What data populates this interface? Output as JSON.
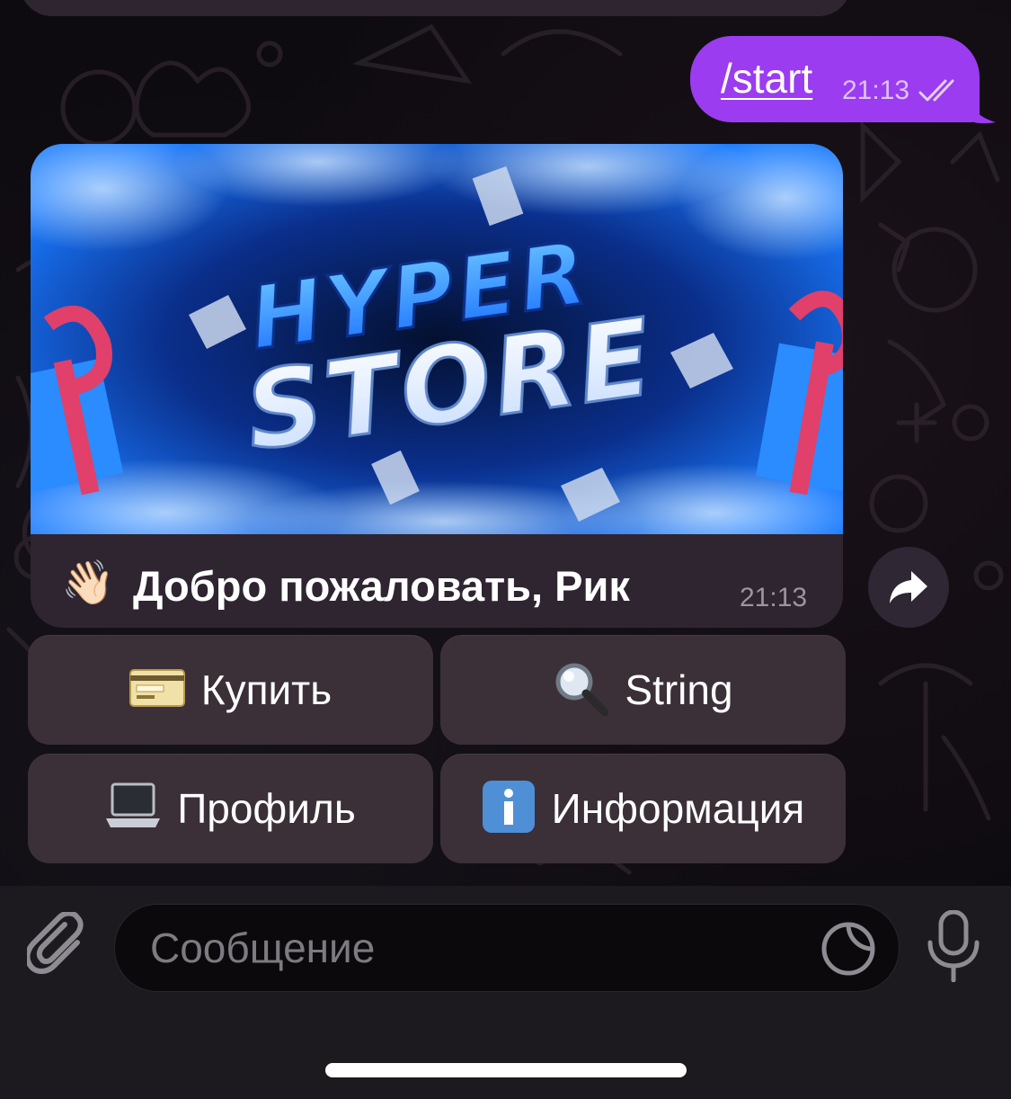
{
  "outgoing_message": {
    "text": "/start",
    "time": "21:13",
    "read_status_icon": "double-check-icon"
  },
  "incoming_message": {
    "banner": {
      "line1": "HYPER",
      "line2": "STORE"
    },
    "emoji": "👋🏻",
    "text": "Добро пожаловать, Рик",
    "time": "21:13"
  },
  "share_icon": "share-arrow-icon",
  "keyboard": [
    {
      "emoji": "💳",
      "label": "Купить"
    },
    {
      "emoji": "🔍",
      "label": "String"
    },
    {
      "emoji": "💻",
      "label": "Профиль"
    },
    {
      "emoji": "ℹ️",
      "label": "Информация"
    }
  ],
  "input_bar": {
    "placeholder": "Сообщение",
    "attach_icon": "paperclip-icon",
    "sticker_icon": "sticker-icon",
    "mic_icon": "microphone-icon"
  },
  "colors": {
    "accent_outgoing": "#9b3cf0",
    "bubble_incoming": "#2e2531",
    "keyboard_button": "#3b3038",
    "banner_blue": "#1f7bff"
  }
}
